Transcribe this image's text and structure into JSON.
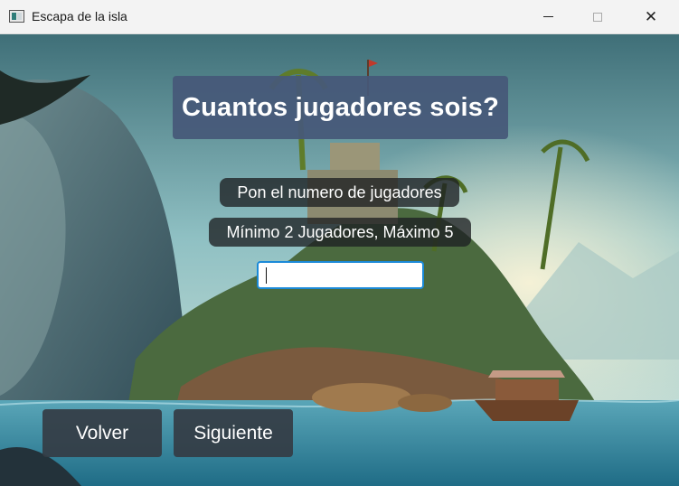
{
  "window": {
    "title": "Escapa de la isla",
    "icon": "app-window-icon",
    "controls": [
      "minimize-icon",
      "maximize-icon",
      "close-icon"
    ],
    "close_glyph": "✕"
  },
  "screen": {
    "heading": "Cuantos jugadores sois?",
    "instruction": "Pon el numero de jugadores",
    "limits": "Mínimo 2 Jugadores, Máximo 5",
    "player_input": {
      "value": "",
      "placeholder": ""
    },
    "back_label": "Volver",
    "next_label": "Siguiente"
  },
  "colors": {
    "heading_bg": "#465878",
    "label_bg": "#1e2022",
    "button_bg": "#343c44",
    "input_focus": "#1b8ad8",
    "water": "#3f8fa8",
    "sky": "#9fc9cc"
  }
}
